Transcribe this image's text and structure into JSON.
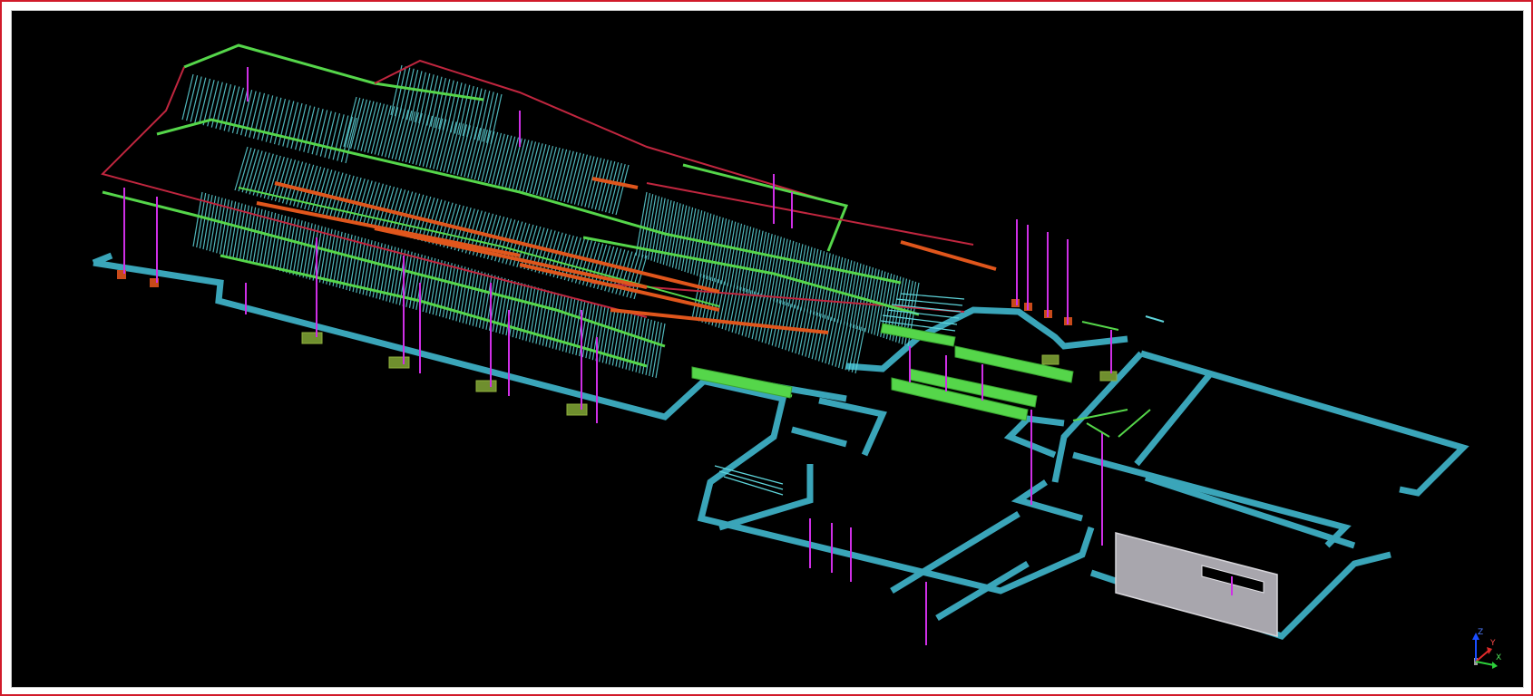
{
  "viewport": {
    "name": "3D model view",
    "background": "#000000"
  },
  "colors": {
    "frame_border": "#d11a2a",
    "wall_outline": "#3aa5b9",
    "joist": "#5fd6dc",
    "beam_green": "#55d64a",
    "beam_orange": "#e0561c",
    "beam_red": "#c0263f",
    "column_magenta": "#cf2fe6",
    "footing_olive": "#6f8f2e",
    "panel_grey": "#a8a6ad",
    "axis_z": "#1a4dff",
    "axis_y": "#e02a2a",
    "axis_x": "#2ccf3a"
  },
  "orientation_gizmo": {
    "axis_x_label": "X",
    "axis_y_label": "Y",
    "axis_z_label": "Z"
  }
}
